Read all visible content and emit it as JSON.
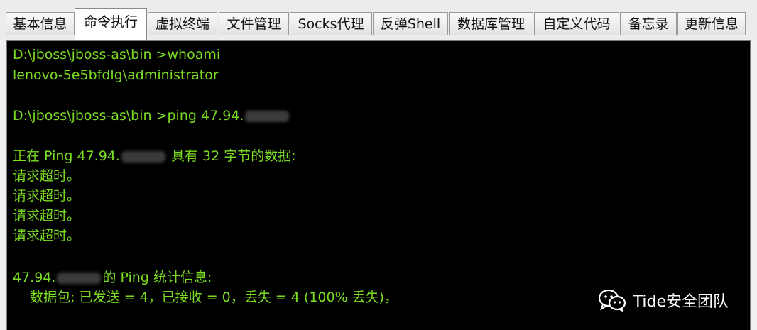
{
  "tabs": [
    {
      "label": "基本信息",
      "active": false
    },
    {
      "label": "命令执行",
      "active": true
    },
    {
      "label": "虚拟终端",
      "active": false
    },
    {
      "label": "文件管理",
      "active": false
    },
    {
      "label": "Socks代理",
      "active": false
    },
    {
      "label": "反弹Shell",
      "active": false
    },
    {
      "label": "数据库管理",
      "active": false
    },
    {
      "label": "自定义代码",
      "active": false
    },
    {
      "label": "备忘录",
      "active": false
    },
    {
      "label": "更新信息",
      "active": false
    }
  ],
  "terminal": {
    "text_color": "#7bdc22",
    "background": "#000000",
    "lines": {
      "l1": "D:\\jboss\\jboss-as\\bin >whoami",
      "l2": "lenovo-5e5bfdlg\\administrator",
      "l3_prefix": "D:\\jboss\\jboss-as\\bin >ping 47.94.",
      "l4_prefix": "正在 Ping 47.94.",
      "l4_suffix": " 具有 32 字节的数据:",
      "timeout": "请求超时。",
      "l9_prefix": "47.94.",
      "l9_suffix": "的 Ping 统计信息:",
      "l10": "    数据包: 已发送 = 4，已接收 = 0，丢失 = 4 (100% 丢失)，"
    }
  },
  "watermark": {
    "text": "Tide安全团队",
    "icon": "wechat-icon"
  }
}
